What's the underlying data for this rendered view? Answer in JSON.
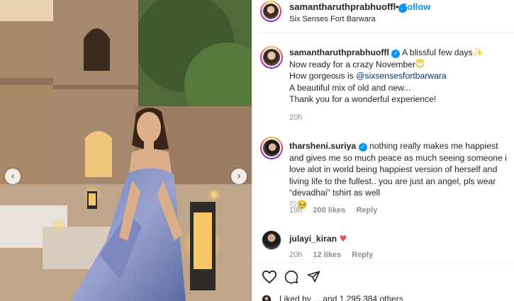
{
  "post": {
    "username": "samantharuthprabhuoffl",
    "follow_label": "Follow",
    "separator": "•",
    "location": "Six Senses Fort Barwara"
  },
  "nav": {
    "prev_glyph": "‹",
    "next_glyph": "›"
  },
  "caption": {
    "username": "samantharuthprabhuoffl",
    "line1": "A blissful few days",
    "line1_emoji": "✨",
    "line2": "Now ready for a crazy November",
    "line2_emoji": "😇",
    "line3_prefix": "How gorgeous is ",
    "line3_mention": "@sixsensesfortbarwara",
    "line4": "A beautiful mix of old and new...",
    "line5": "Thank you for a wonderful experience!",
    "time": "20h"
  },
  "comments": [
    {
      "username": "tharsheni.suriya",
      "text": "nothing really makes me happiest and gives me so much peace as much seeing someone i love alot in world being happiest version of herself and living life to the fullest.. you are just an angel, pls wear “devadhai” tshirt as well",
      "emoji": "♡🥺",
      "time": "19h",
      "likes": "200 likes",
      "reply": "Reply"
    },
    {
      "username": "julayi_kiran",
      "text": "♥",
      "time": "20h",
      "likes": "12 likes",
      "reply": "Reply"
    }
  ],
  "actions": {
    "like_icon": "heart-outline",
    "comment_icon": "speech-bubble",
    "share_icon": "paper-plane"
  },
  "likes_row": {
    "text": "Liked by ... and 1,295,384 others"
  },
  "colors": {
    "accent_blue": "#0095f6",
    "mention": "#00376b",
    "muted": "#8e8e8e",
    "heart_red": "#ed4956"
  }
}
